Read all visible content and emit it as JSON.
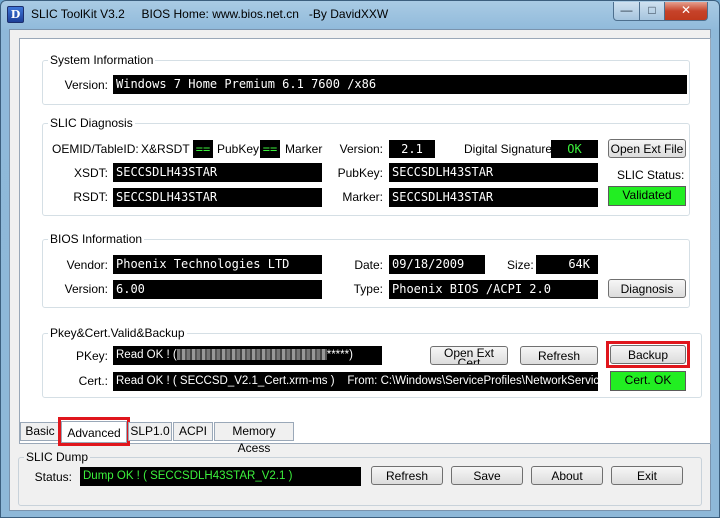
{
  "window": {
    "title": "SLIC ToolKit V3.2     BIOS Home: www.bios.net.cn   -By DavidXXW",
    "icon_letter": "D",
    "controls": {
      "minimize": "—",
      "maximize": "□",
      "close": "✕"
    }
  },
  "system_info": {
    "legend": "System Information",
    "version_label": "Version:",
    "version_value": "Windows 7 Home Premium 6.1 7600 /x86"
  },
  "slic_diag": {
    "legend": "SLIC Diagnosis",
    "oem_label": "OEMID/TableID:",
    "oem_value": "X&RSDT",
    "eq1": "==",
    "pubkey_label": "PubKey",
    "eq2": "==",
    "marker_label": "Marker",
    "version_label": "Version:",
    "version_value": "2.1",
    "digsig_label": "Digital Signature:",
    "digsig_value": "OK",
    "open_ext_file": "Open Ext File",
    "xsdt_label": "XSDT:",
    "xsdt_value": "SECCSDLH43STAR",
    "pubkey_field_label": "PubKey:",
    "pubkey_value": "SECCSDLH43STAR",
    "slic_status_label": "SLIC Status:",
    "rsdt_label": "RSDT:",
    "rsdt_value": "SECCSDLH43STAR",
    "marker_field_label": "Marker:",
    "marker_value": "SECCSDLH43STAR",
    "slic_status_value": "Validated"
  },
  "bios_info": {
    "legend": "BIOS Information",
    "vendor_label": "Vendor:",
    "vendor_value": "Phoenix Technologies LTD",
    "date_label": "Date:",
    "date_value": "09/18/2009",
    "size_label": "Size:",
    "size_value": "64K",
    "version_label": "Version:",
    "version_value": "6.00",
    "type_label": "Type:",
    "type_value": "Phoenix BIOS /ACPI 2.0",
    "diagnosis_button": "Diagnosis"
  },
  "pkey_cert": {
    "legend": "Pkey&Cert.Valid&Backup",
    "pkey_label": "PKey:",
    "pkey_value_prefix": "Read OK ! (",
    "pkey_value_suffix": "*****)",
    "open_ext_cert": "Open Ext Cert",
    "refresh_button": "Refresh",
    "backup_button": "Backup",
    "cert_label": "Cert.:",
    "cert_value": "Read OK ! ( SECCSD_V2.1_Cert.xrm-ms )",
    "cert_from": "From: C:\\Windows\\ServiceProfiles\\NetworkService",
    "cert_status": "Cert. OK"
  },
  "tabs": [
    "Basic",
    "Advanced",
    "SLP1.0",
    "ACPI",
    "Memory Acess"
  ],
  "slic_dump": {
    "legend": "SLIC Dump",
    "status_label": "Status:",
    "status_value": "Dump OK ! ( SECCSDLH43STAR_V2.1 )",
    "refresh_button": "Refresh",
    "save_button": "Save",
    "about_button": "About",
    "exit_button": "Exit"
  },
  "colors": {
    "highlight": "#e0161c",
    "status_green": "#22ee22",
    "text_green": "#3cf03c"
  }
}
